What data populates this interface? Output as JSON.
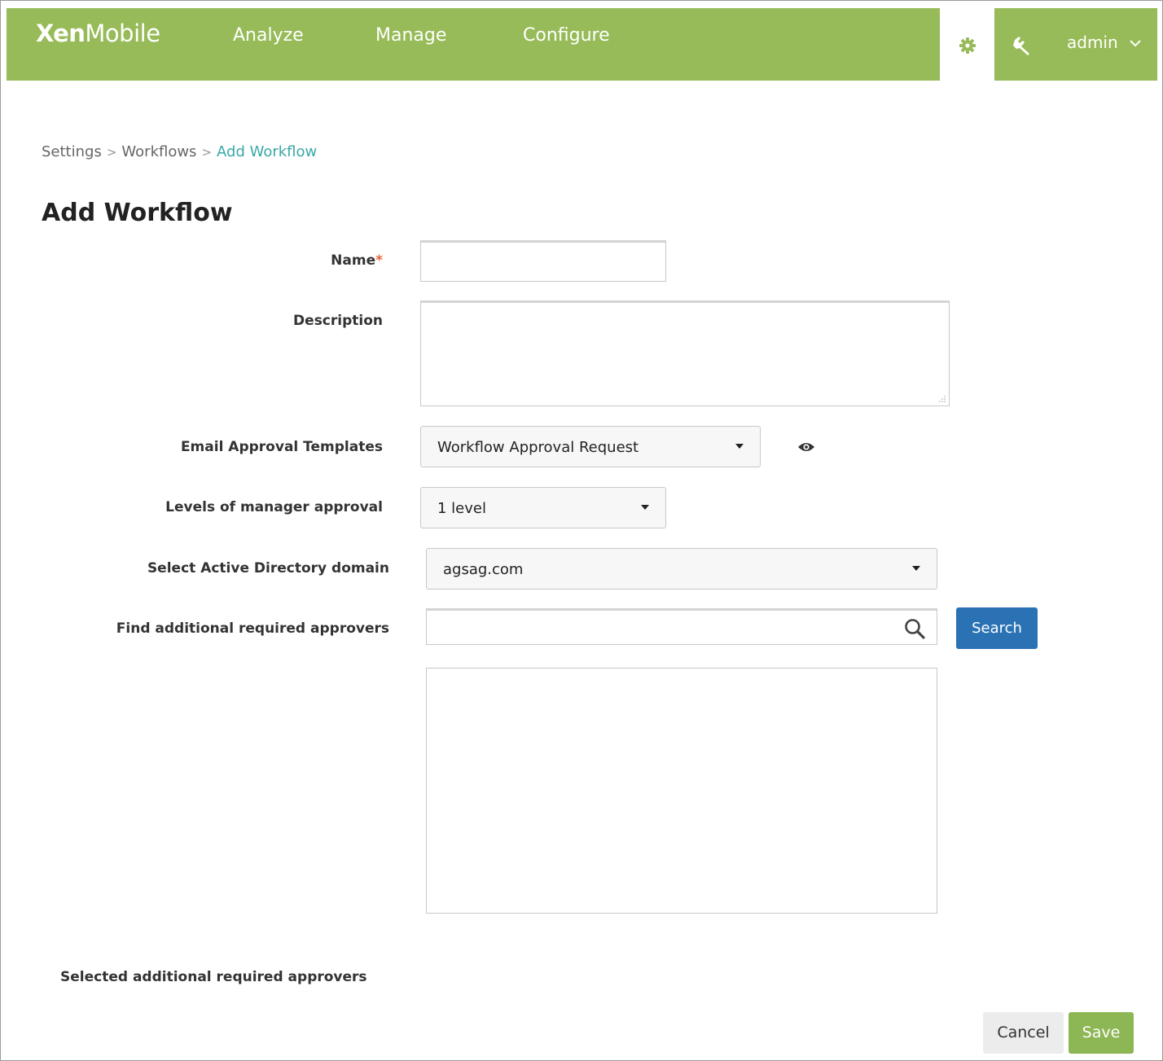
{
  "app": {
    "brand_bold": "Xen",
    "brand_light": "Mobile"
  },
  "nav": {
    "analyze": "Analyze",
    "manage": "Manage",
    "configure": "Configure",
    "user": "admin"
  },
  "breadcrumb": {
    "items": [
      "Settings",
      "Workflows"
    ],
    "current": "Add Workflow",
    "separator": ">"
  },
  "page": {
    "title": "Add Workflow"
  },
  "form": {
    "name_label": "Name",
    "required_mark": "*",
    "description_label": "Description",
    "email_templates_label": "Email Approval Templates",
    "email_templates_value": "Workflow Approval Request",
    "levels_label": "Levels of manager approval",
    "levels_value": "1 level",
    "ad_domain_label": "Select Active Directory domain",
    "ad_domain_value": "agsag.com",
    "find_approvers_label": "Find additional required approvers",
    "search_button": "Search",
    "selected_approvers_label": "Selected additional required approvers"
  },
  "actions": {
    "cancel": "Cancel",
    "save": "Save"
  },
  "colors": {
    "header": "#97bb58",
    "breadcrumb_current": "#3aa8a8",
    "search_button": "#2a72b4",
    "save_button": "#8db654",
    "required": "#e8643c"
  },
  "icons": [
    "gear-icon",
    "wrench-icon",
    "chevron-down-icon",
    "eye-icon",
    "search-icon",
    "resize-grip-icon"
  ]
}
